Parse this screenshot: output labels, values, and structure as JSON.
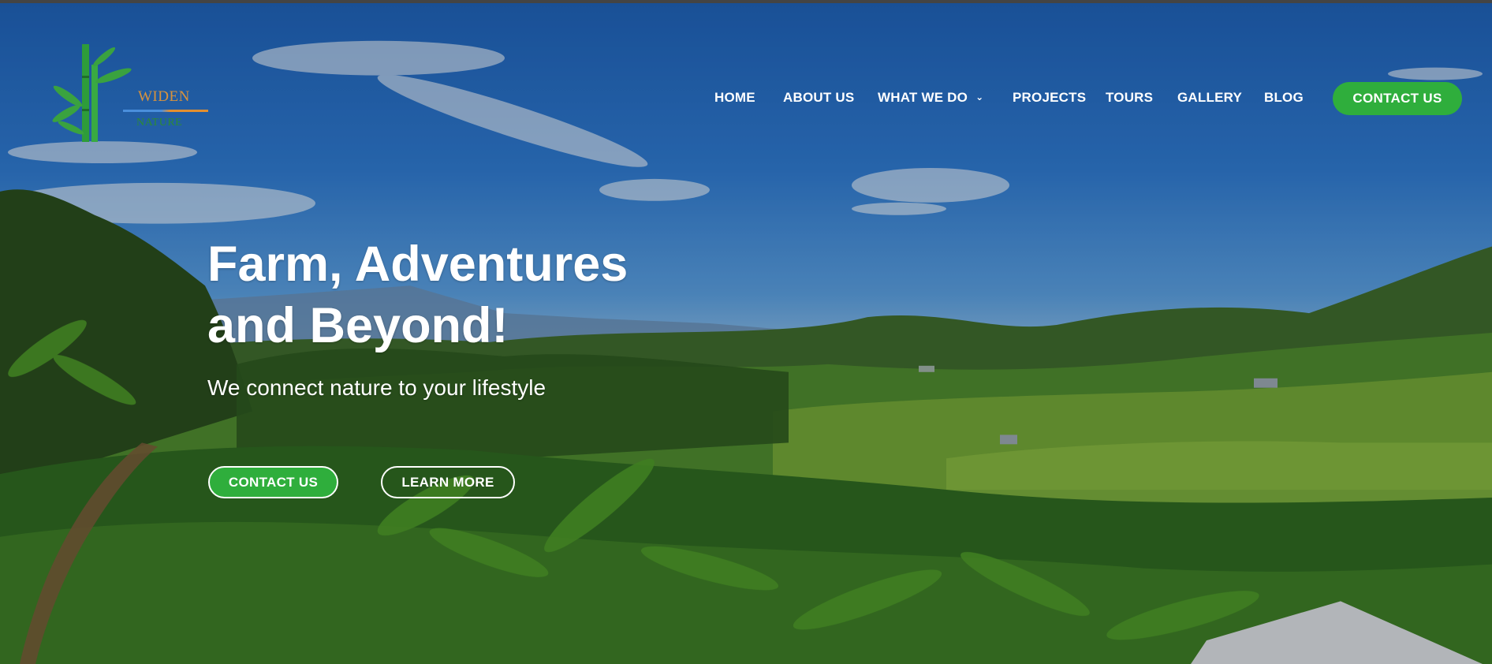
{
  "brand": {
    "line1": "WIDEN",
    "line2": "NATURE",
    "colors": {
      "green": "#2fae3c",
      "orange": "#d8923c",
      "blue": "#4a8fdc"
    }
  },
  "nav": {
    "items": [
      {
        "label": "HOME"
      },
      {
        "label": "ABOUT US"
      },
      {
        "label": "WHAT WE DO",
        "icon": "chevron-down-icon"
      },
      {
        "label": "PROJECTS"
      },
      {
        "label": "TOURS"
      },
      {
        "label": "GALLERY"
      },
      {
        "label": "BLOG"
      }
    ],
    "cta": "CONTACT US"
  },
  "hero": {
    "title_line1": "Farm, Adventures",
    "title_line2": "and Beyond!",
    "subtitle": "We connect nature to your lifestyle",
    "primary_button": "CONTACT US",
    "secondary_button": "LEARN MORE"
  },
  "theme": {
    "accent": "#2fae3c",
    "text": "#ffffff"
  }
}
